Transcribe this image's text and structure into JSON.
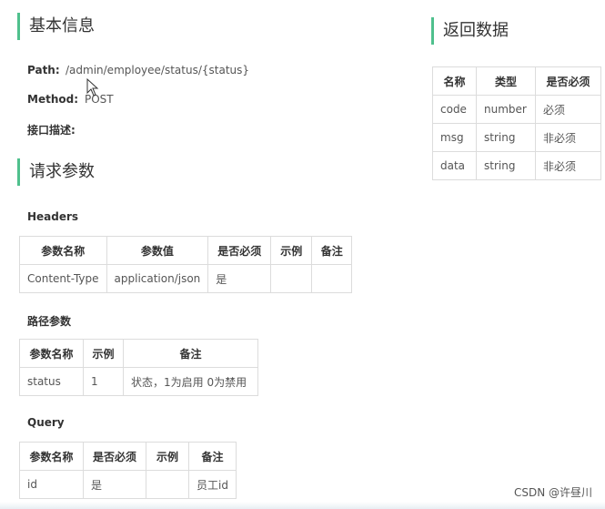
{
  "basic": {
    "title": "基本信息",
    "path_label": "Path:",
    "path_value": "/admin/employee/status/{status}",
    "method_label": "Method:",
    "method_value": "POST",
    "desc_label": "接口描述:"
  },
  "request": {
    "title": "请求参数",
    "headers_label": "Headers",
    "headers_table": {
      "columns": [
        "参数名称",
        "参数值",
        "是否必须",
        "示例",
        "备注"
      ],
      "rows": [
        [
          "Content-Type",
          "application/json",
          "是",
          "",
          ""
        ]
      ]
    },
    "path_params_label": "路径参数",
    "path_table": {
      "columns": [
        "参数名称",
        "示例",
        "备注"
      ],
      "rows": [
        [
          "status",
          "1",
          "状态，1为启用 0为禁用"
        ]
      ]
    },
    "query_label": "Query",
    "query_table": {
      "columns": [
        "参数名称",
        "是否必须",
        "示例",
        "备注"
      ],
      "rows": [
        [
          "id",
          "是",
          "",
          "员工id"
        ]
      ]
    }
  },
  "response": {
    "title": "返回数据",
    "table": {
      "columns": [
        "名称",
        "类型",
        "是否必须"
      ],
      "rows": [
        [
          "code",
          "number",
          "必须"
        ],
        [
          "msg",
          "string",
          "非必须"
        ],
        [
          "data",
          "string",
          "非必须"
        ]
      ]
    }
  },
  "watermark": "CSDN @许昼川",
  "colors": {
    "accent": "#4fc08d",
    "border": "#dcdcdc"
  }
}
